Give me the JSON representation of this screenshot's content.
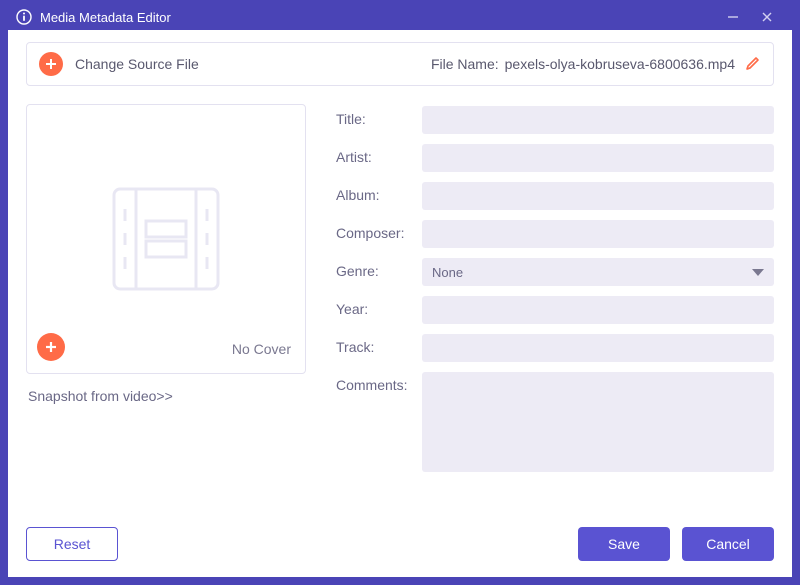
{
  "window": {
    "title": "Media Metadata Editor"
  },
  "source": {
    "change_label": "Change Source File",
    "file_name_label": "File Name:",
    "file_name_value": "pexels-olya-kobruseva-6800636.mp4"
  },
  "cover": {
    "no_cover_label": "No Cover",
    "snapshot_link": "Snapshot from video>>"
  },
  "form": {
    "labels": {
      "title": "Title:",
      "artist": "Artist:",
      "album": "Album:",
      "composer": "Composer:",
      "genre": "Genre:",
      "year": "Year:",
      "track": "Track:",
      "comments": "Comments:"
    },
    "values": {
      "title": "",
      "artist": "",
      "album": "",
      "composer": "",
      "genre_selected": "None",
      "year": "",
      "track": "",
      "comments": ""
    }
  },
  "buttons": {
    "reset": "Reset",
    "save": "Save",
    "cancel": "Cancel"
  }
}
